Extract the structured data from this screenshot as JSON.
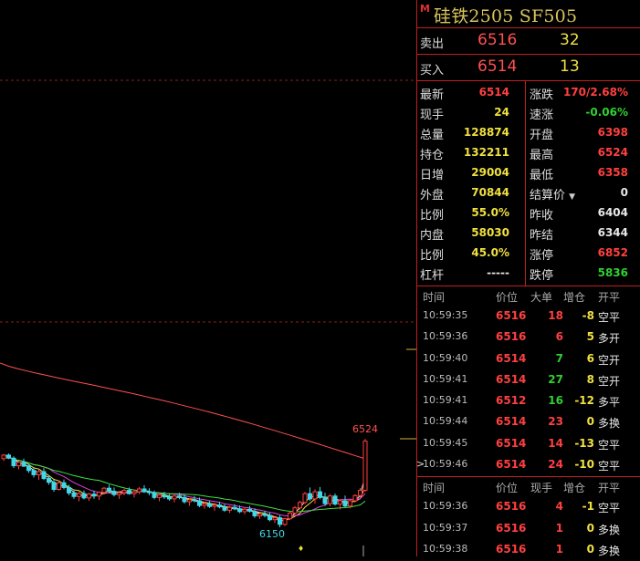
{
  "title": {
    "marker": "M",
    "text": "硅铁2505  SF505"
  },
  "quote": {
    "sell": {
      "label": "卖出",
      "price": "6516",
      "volume": "32"
    },
    "buy": {
      "label": "买入",
      "price": "6514",
      "volume": "13"
    }
  },
  "stats": [
    {
      "l1": "最新",
      "v1": "6514",
      "c1": "red",
      "l2": "涨跌",
      "v2": "170/2.68%",
      "c2": "red"
    },
    {
      "l1": "现手",
      "v1": "24",
      "c1": "yellow",
      "l2": "速涨",
      "v2": "-0.06%",
      "c2": "green"
    },
    {
      "l1": "总量",
      "v1": "128874",
      "c1": "yellow",
      "l2": "开盘",
      "v2": "6398",
      "c2": "red"
    },
    {
      "l1": "持仓",
      "v1": "132211",
      "c1": "yellow",
      "l2": "最高",
      "v2": "6524",
      "c2": "red"
    },
    {
      "l1": "日增",
      "v1": "29004",
      "c1": "yellow",
      "l2": "最低",
      "v2": "6358",
      "c2": "red"
    },
    {
      "l1": "外盘",
      "v1": "70844",
      "c1": "yellow",
      "l2": "结算价",
      "v2": "0",
      "c2": "white"
    },
    {
      "l1": "比例",
      "v1": "55.0%",
      "c1": "yellow",
      "l2": "昨收",
      "v2": "6404",
      "c2": "white"
    },
    {
      "l1": "内盘",
      "v1": "58030",
      "c1": "yellow",
      "l2": "昨结",
      "v2": "6344",
      "c2": "white"
    },
    {
      "l1": "比例",
      "v1": "45.0%",
      "c1": "yellow",
      "l2": "涨停",
      "v2": "6852",
      "c2": "red"
    },
    {
      "l1": "杠杆",
      "v1": "-----",
      "c1": "white",
      "l2": "跌停",
      "v2": "5836",
      "c2": "green"
    }
  ],
  "ticks1": {
    "headers": [
      "时间",
      "价位",
      "大单",
      "增仓",
      "开平"
    ],
    "rows": [
      {
        "time": "10:59:35",
        "price": "6516",
        "vol": "18",
        "oi": "-8",
        "type": "空平",
        "pc": "red",
        "vc": "red",
        "oc": "yellow"
      },
      {
        "time": "10:59:36",
        "price": "6516",
        "vol": "6",
        "oi": "5",
        "type": "多开",
        "pc": "red",
        "vc": "red",
        "oc": "yellow"
      },
      {
        "time": "10:59:40",
        "price": "6514",
        "vol": "7",
        "oi": "6",
        "type": "空开",
        "pc": "red",
        "vc": "green",
        "oc": "yellow"
      },
      {
        "time": "10:59:41",
        "price": "6514",
        "vol": "27",
        "oi": "8",
        "type": "空开",
        "pc": "red",
        "vc": "green",
        "oc": "yellow"
      },
      {
        "time": "10:59:41",
        "price": "6512",
        "vol": "16",
        "oi": "-12",
        "type": "多平",
        "pc": "red",
        "vc": "green",
        "oc": "yellow"
      },
      {
        "time": "10:59:44",
        "price": "6514",
        "vol": "23",
        "oi": "0",
        "type": "多换",
        "pc": "red",
        "vc": "red",
        "oc": "yellow"
      },
      {
        "time": "10:59:45",
        "price": "6514",
        "vol": "14",
        "oi": "-13",
        "type": "空平",
        "pc": "red",
        "vc": "red",
        "oc": "yellow"
      },
      {
        "time": "10:59:46",
        "price": "6514",
        "vol": "24",
        "oi": "-10",
        "type": "空平",
        "pc": "red",
        "vc": "red",
        "oc": "yellow"
      }
    ]
  },
  "ticks2": {
    "headers": [
      "时间",
      "价位",
      "现手",
      "增仓",
      "开平"
    ],
    "rows": [
      {
        "time": "10:59:36",
        "price": "6516",
        "vol": "4",
        "oi": "-1",
        "type": "空平",
        "pc": "red",
        "vc": "red",
        "oc": "yellow"
      },
      {
        "time": "10:59:37",
        "price": "6516",
        "vol": "1",
        "oi": "0",
        "type": "多换",
        "pc": "red",
        "vc": "red",
        "oc": "yellow"
      },
      {
        "time": "10:59:38",
        "price": "6516",
        "vol": "1",
        "oi": "0",
        "type": "多换",
        "pc": "red",
        "vc": "red",
        "oc": "yellow"
      }
    ]
  },
  "chart": {
    "high_label": "6524",
    "low_label": "6150",
    "high": 6524,
    "low": 6150,
    "ma_colors": [
      "#f0f0f0",
      "#f0e040",
      "#e040e0",
      "#40e040",
      "#ff5050"
    ],
    "candles": [
      [
        6440,
        6460,
        6430,
        6455
      ],
      [
        6455,
        6462,
        6438,
        6442
      ],
      [
        6442,
        6450,
        6400,
        6410
      ],
      [
        6410,
        6430,
        6395,
        6425
      ],
      [
        6425,
        6440,
        6405,
        6408
      ],
      [
        6408,
        6418,
        6380,
        6390
      ],
      [
        6390,
        6400,
        6360,
        6372
      ],
      [
        6372,
        6392,
        6350,
        6385
      ],
      [
        6385,
        6400,
        6350,
        6356
      ],
      [
        6356,
        6370,
        6330,
        6340
      ],
      [
        6340,
        6350,
        6300,
        6310
      ],
      [
        6310,
        6345,
        6305,
        6338
      ],
      [
        6338,
        6352,
        6310,
        6318
      ],
      [
        6318,
        6330,
        6285,
        6295
      ],
      [
        6295,
        6310,
        6270,
        6280
      ],
      [
        6280,
        6300,
        6260,
        6292
      ],
      [
        6292,
        6305,
        6268,
        6274
      ],
      [
        6274,
        6296,
        6262,
        6290
      ],
      [
        6290,
        6305,
        6270,
        6282
      ],
      [
        6282,
        6302,
        6265,
        6298
      ],
      [
        6298,
        6320,
        6290,
        6315
      ],
      [
        6315,
        6330,
        6295,
        6302
      ],
      [
        6302,
        6318,
        6280,
        6288
      ],
      [
        6288,
        6300,
        6270,
        6296
      ],
      [
        6296,
        6312,
        6285,
        6306
      ],
      [
        6306,
        6318,
        6288,
        6292
      ],
      [
        6292,
        6310,
        6276,
        6300
      ],
      [
        6300,
        6320,
        6290,
        6312
      ],
      [
        6312,
        6328,
        6295,
        6300
      ],
      [
        6300,
        6315,
        6285,
        6296
      ],
      [
        6296,
        6305,
        6268,
        6276
      ],
      [
        6276,
        6290,
        6260,
        6286
      ],
      [
        6286,
        6300,
        6270,
        6278
      ],
      [
        6278,
        6292,
        6262,
        6270
      ],
      [
        6270,
        6286,
        6255,
        6282
      ],
      [
        6282,
        6296,
        6268,
        6276
      ],
      [
        6276,
        6290,
        6250,
        6258
      ],
      [
        6258,
        6272,
        6240,
        6266
      ],
      [
        6266,
        6282,
        6255,
        6262
      ],
      [
        6262,
        6276,
        6235,
        6242
      ],
      [
        6242,
        6258,
        6228,
        6250
      ],
      [
        6250,
        6262,
        6232,
        6238
      ],
      [
        6238,
        6252,
        6220,
        6244
      ],
      [
        6244,
        6258,
        6230,
        6236
      ],
      [
        6236,
        6248,
        6215,
        6222
      ],
      [
        6222,
        6240,
        6210,
        6234
      ],
      [
        6234,
        6248,
        6222,
        6228
      ],
      [
        6228,
        6242,
        6210,
        6216
      ],
      [
        6216,
        6232,
        6205,
        6226
      ],
      [
        6226,
        6240,
        6212,
        6218
      ],
      [
        6218,
        6230,
        6190,
        6198
      ],
      [
        6198,
        6212,
        6185,
        6206
      ],
      [
        6206,
        6220,
        6192,
        6200
      ],
      [
        6200,
        6212,
        6175,
        6182
      ],
      [
        6182,
        6196,
        6168,
        6190
      ],
      [
        6190,
        6200,
        6150,
        6162
      ],
      [
        6162,
        6190,
        6155,
        6186
      ],
      [
        6186,
        6216,
        6180,
        6210
      ],
      [
        6210,
        6240,
        6200,
        6232
      ],
      [
        6232,
        6262,
        6225,
        6255
      ],
      [
        6255,
        6300,
        6248,
        6292
      ],
      [
        6292,
        6318,
        6262,
        6270
      ],
      [
        6270,
        6310,
        6250,
        6300
      ],
      [
        6300,
        6320,
        6268,
        6276
      ],
      [
        6276,
        6296,
        6240,
        6250
      ],
      [
        6250,
        6290,
        6238,
        6282
      ],
      [
        6282,
        6292,
        6242,
        6248
      ],
      [
        6248,
        6268,
        6225,
        6262
      ],
      [
        6262,
        6284,
        6235,
        6240
      ],
      [
        6240,
        6268,
        6230,
        6262
      ],
      [
        6262,
        6290,
        6255,
        6284
      ],
      [
        6284,
        6316,
        6278,
        6306
      ],
      [
        6306,
        6524,
        6300,
        6514
      ]
    ],
    "bottom_marker": "♦"
  }
}
